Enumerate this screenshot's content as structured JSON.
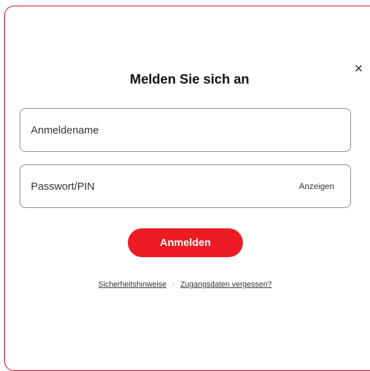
{
  "dialog": {
    "title": "Melden Sie sich an",
    "close_icon": "close-icon",
    "close_glyph": "×"
  },
  "form": {
    "username_placeholder": "Anmeldename",
    "username_value": "",
    "password_placeholder": "Passwort/PIN",
    "password_value": "",
    "show_password_label": "Anzeigen",
    "submit_label": "Anmelden"
  },
  "links": {
    "security_label": "Sicherheitshinweise",
    "separator": "·",
    "forgot_label": "Zugangsdaten vergessen?"
  },
  "colors": {
    "accent": "#eb1c24",
    "frame_border": "#c2101f"
  }
}
